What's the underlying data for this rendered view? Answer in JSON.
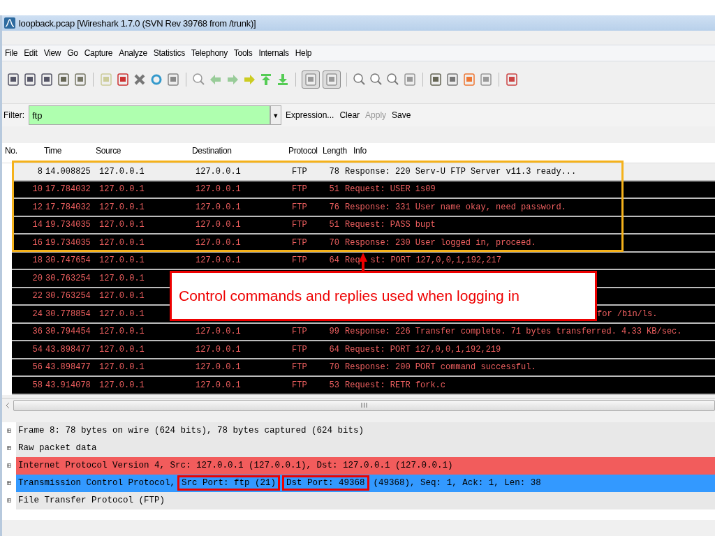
{
  "window": {
    "title": "loopback.pcap  [Wireshark 1.7.0  (SVN Rev 39768 from /trunk)]"
  },
  "menu": [
    "File",
    "Edit",
    "View",
    "Go",
    "Capture",
    "Analyze",
    "Statistics",
    "Telephony",
    "Tools",
    "Internals",
    "Help"
  ],
  "filter": {
    "label": "Filter:",
    "value": "ftp",
    "dropdown": "▾",
    "actions": [
      {
        "label": "Expression...",
        "disabled": false
      },
      {
        "label": "Clear",
        "disabled": false
      },
      {
        "label": "Apply",
        "disabled": true
      },
      {
        "label": "Save",
        "disabled": false
      }
    ]
  },
  "packet_list": {
    "columns": [
      "No.",
      "Time",
      "Source",
      "Destination",
      "Protocol",
      "Length",
      "Info"
    ],
    "rows": [
      {
        "no": "8",
        "time": "14.008825",
        "source": "127.0.0.1",
        "destination": "127.0.0.1",
        "protocol": "FTP",
        "length": "78",
        "info": "Response: 220 Serv-U FTP Server v11.3 ready...",
        "selected": true
      },
      {
        "no": "10",
        "time": "17.784032",
        "source": "127.0.0.1",
        "destination": "127.0.0.1",
        "protocol": "FTP",
        "length": "51",
        "info": "Request: USER is09",
        "selected": false
      },
      {
        "no": "12",
        "time": "17.784032",
        "source": "127.0.0.1",
        "destination": "127.0.0.1",
        "protocol": "FTP",
        "length": "76",
        "info": "Response: 331 User name okay, need password.",
        "selected": false
      },
      {
        "no": "14",
        "time": "19.734035",
        "source": "127.0.0.1",
        "destination": "127.0.0.1",
        "protocol": "FTP",
        "length": "51",
        "info": "Request: PASS bupt",
        "selected": false
      },
      {
        "no": "16",
        "time": "19.734035",
        "source": "127.0.0.1",
        "destination": "127.0.0.1",
        "protocol": "FTP",
        "length": "70",
        "info": "Response: 230 User logged in, proceed.",
        "selected": false
      },
      {
        "no": "18",
        "time": "30.747654",
        "source": "127.0.0.1",
        "destination": "127.0.0.1",
        "protocol": "FTP",
        "length": "64",
        "info": "Req",
        "info_after": "st: PORT 127,0,0,1,192,217",
        "selected": false
      },
      {
        "no": "20",
        "time": "30.763254",
        "source": "127.0.0.1",
        "selected": false
      },
      {
        "no": "22",
        "time": "30.763254",
        "source": "127.0.0.1",
        "selected": false
      },
      {
        "no": "24",
        "time": "30.778854",
        "source": "127.0.0.1",
        "info_tail": "for /bin/ls.",
        "selected": false
      },
      {
        "no": "36",
        "time": "30.794454",
        "source": "127.0.0.1",
        "destination": "127.0.0.1",
        "protocol": "FTP",
        "length": "99",
        "info": "Response: 226 Transfer complete. 71 bytes transferred. 4.33 KB/sec.",
        "selected": false
      },
      {
        "no": "54",
        "time": "43.898477",
        "source": "127.0.0.1",
        "destination": "127.0.0.1",
        "protocol": "FTP",
        "length": "64",
        "info": "Request: PORT 127,0,0,1,192,219",
        "selected": false
      },
      {
        "no": "56",
        "time": "43.898477",
        "source": "127.0.0.1",
        "destination": "127.0.0.1",
        "protocol": "FTP",
        "length": "70",
        "info": "Response: 200 PORT command successful.",
        "selected": false
      },
      {
        "no": "58",
        "time": "43.914078",
        "source": "127.0.0.1",
        "destination": "127.0.0.1",
        "protocol": "FTP",
        "length": "53",
        "info": "Request: RETR fork.c",
        "selected": false
      }
    ]
  },
  "details": [
    {
      "expander": "⊞",
      "color": "#e8e8e8",
      "parts": [
        {
          "text": "Frame 8: 78 bytes on wire (624 bits), 78 bytes captured (624 bits)",
          "highlighted": false
        }
      ]
    },
    {
      "expander": "⊞",
      "color": "#e8e8e8",
      "parts": [
        {
          "text": "Raw packet data",
          "highlighted": false
        }
      ]
    },
    {
      "expander": "⊞",
      "color": "#f25c5c",
      "parts": [
        {
          "text": "Internet Protocol Version 4, Src: 127.0.0.1 (127.0.0.1), Dst: 127.0.0.1 (127.0.0.1)",
          "highlighted": false
        }
      ]
    },
    {
      "expander": "⊞",
      "color": "#3399ff",
      "parts": [
        {
          "text": "Transmission Control Protocol,",
          "highlighted": false
        },
        {
          "text": "Src Port: ftp (21)",
          "highlighted": true
        },
        {
          "text": "Dst Port: 49368",
          "highlighted": true
        },
        {
          "text": "(49368), Seq: 1, Ack: 1, Len: 38",
          "highlighted": false
        }
      ]
    },
    {
      "expander": "⊞",
      "color": "#e8e8e8",
      "parts": [
        {
          "text": "File Transfer Protocol (FTP)",
          "highlighted": false
        }
      ]
    }
  ],
  "annotation": {
    "callout": "Control commands and replies used when logging in"
  }
}
